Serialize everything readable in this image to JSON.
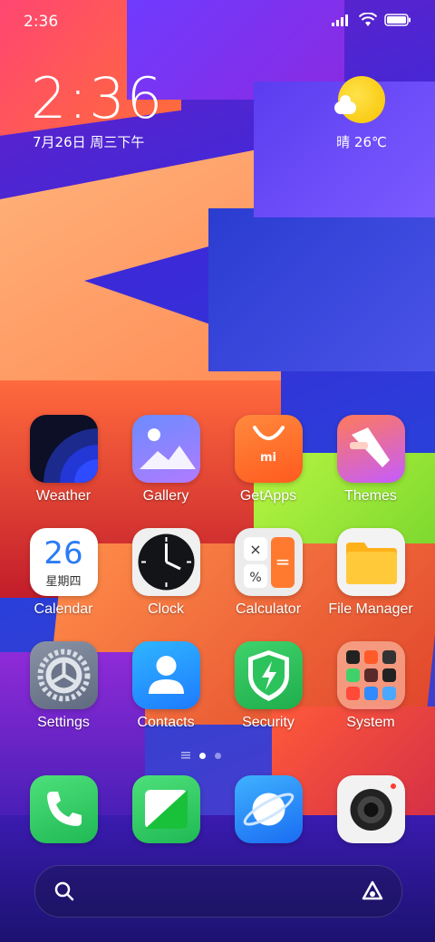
{
  "status_bar": {
    "time": "2:36"
  },
  "clock_widget": {
    "time": "2:36",
    "date": "7月26日 周三下午"
  },
  "weather_widget": {
    "text": "晴 26℃"
  },
  "apps": [
    {
      "label": "Weather",
      "icon": "weather-icon"
    },
    {
      "label": "Gallery",
      "icon": "gallery-icon"
    },
    {
      "label": "GetApps",
      "icon": "getapps-icon"
    },
    {
      "label": "Themes",
      "icon": "themes-icon"
    },
    {
      "label": "Calendar",
      "icon": "calendar-icon"
    },
    {
      "label": "Clock",
      "icon": "clock-icon"
    },
    {
      "label": "Calculator",
      "icon": "calculator-icon"
    },
    {
      "label": "File Manager",
      "icon": "folder-icon"
    },
    {
      "label": "Settings",
      "icon": "settings-gear-icon"
    },
    {
      "label": "Contacts",
      "icon": "contacts-icon"
    },
    {
      "label": "Security",
      "icon": "security-shield-icon"
    },
    {
      "label": "System",
      "icon": "system-folder-icon"
    }
  ],
  "calendar_icon": {
    "day": "26",
    "weekday": "星期四"
  },
  "getapps_icon": {
    "mark": "mi"
  },
  "dock": [
    {
      "icon": "phone-icon"
    },
    {
      "icon": "messages-icon"
    },
    {
      "icon": "browser-icon"
    },
    {
      "icon": "camera-icon"
    }
  ]
}
